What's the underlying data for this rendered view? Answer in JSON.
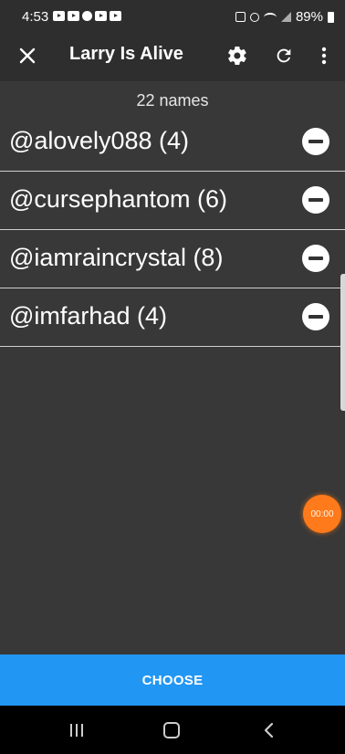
{
  "status_bar": {
    "time": "4:53",
    "battery": "89%"
  },
  "toolbar": {
    "title": "Larry Is Alive",
    "close_icon": "close-icon",
    "settings_icon": "gear-icon",
    "refresh_icon": "refresh-icon",
    "more_icon": "more-vertical-icon"
  },
  "names_count": "22 names",
  "names": [
    {
      "label": "@alovely088 (4)"
    },
    {
      "label": "@cursephantom (6)"
    },
    {
      "label": "@iamraincrystal (8)"
    },
    {
      "label": "@imfarhad (4)"
    }
  ],
  "timer": {
    "label": "00:00"
  },
  "choose_button": {
    "label": "CHOOSE"
  },
  "colors": {
    "background": "#383838",
    "toolbar": "#2e2e2e",
    "accent": "#2196f3",
    "timer": "#ff7a1a"
  }
}
